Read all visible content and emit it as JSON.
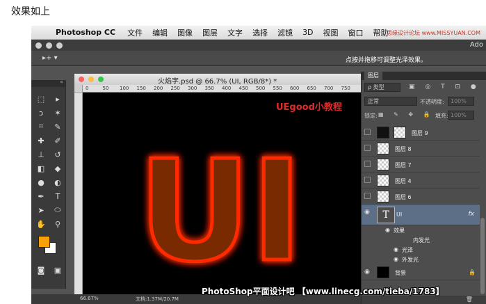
{
  "caption": "效果如上",
  "menubar": {
    "apple": "",
    "app_name": "Photoshop CC",
    "items": [
      "文件",
      "编辑",
      "图像",
      "图层",
      "文字",
      "选择",
      "滤镜",
      "3D",
      "视图",
      "窗口",
      "帮助"
    ],
    "watermark": "思缘设计论坛 www.MISSYUAN.COM"
  },
  "titlebar": {
    "adobe": "Ado"
  },
  "optionsbar": {
    "move_tool": "▸+ ▾",
    "hint": "点按并拖移可调整光泽效果。"
  },
  "document": {
    "title": "火焰字.psd @ 66.7% (UI, RGB/8*) *",
    "ruler_ticks": [
      "0",
      "50",
      "100",
      "150",
      "200",
      "250",
      "300",
      "350",
      "400",
      "450",
      "500",
      "550",
      "600",
      "650",
      "700",
      "750"
    ],
    "brand_text": "UEgood小教程",
    "canvas_text": "UI",
    "status_zoom": "66.67%",
    "status_doc": "文档:1.37M/20.7M",
    "glow_color": "#ff2a00",
    "fill_color": "#7a2a05"
  },
  "watermark_bottom": "PhotoShop平面设计吧 【www.linecg.com/tieba/1783】",
  "tools": {
    "colors": {
      "foreground": "#f7a10a",
      "background": "#ffffff"
    }
  },
  "layers_panel": {
    "tab": "图层",
    "filter_kind": "ρ 类型",
    "filter_icons": "▣ ◎ T ⊡ ●",
    "blend_mode": "正常",
    "opacity_label": "不透明度:",
    "opacity_value": "100%",
    "lock_label": "锁定:",
    "lock_icons": "▦ ✎ ✥ 🔒",
    "fill_label": "填充:",
    "fill_value": "100%",
    "layers": [
      {
        "name": "图层 9",
        "visible": false
      },
      {
        "name": "图层 8",
        "visible": false
      },
      {
        "name": "图层 7",
        "visible": false
      },
      {
        "name": "图层 4",
        "visible": false
      },
      {
        "name": "图层 6",
        "visible": false
      }
    ],
    "selected_layer": {
      "name": "UI",
      "thumb": "T",
      "fx": "fx"
    },
    "effects_label": "效果",
    "effects": [
      "内发光",
      "光泽",
      "外发光"
    ],
    "background_layer": {
      "name": "背景",
      "lock": "🔒"
    },
    "footer": "🗑"
  }
}
